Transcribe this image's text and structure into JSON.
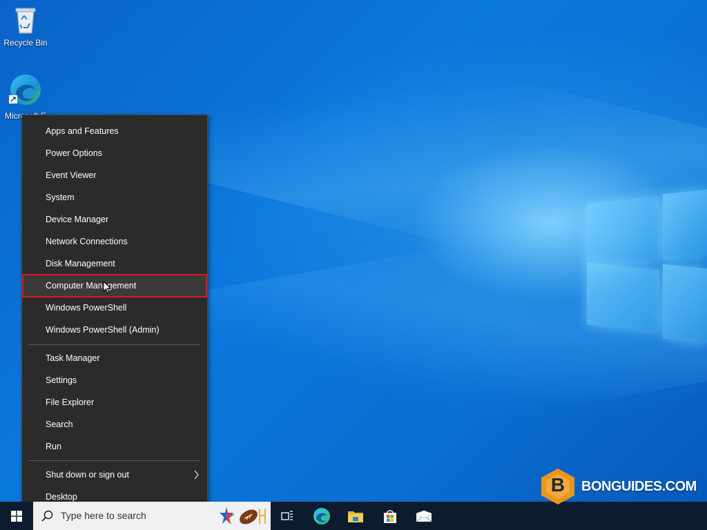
{
  "desktop": {
    "icons": [
      {
        "label": "Recycle Bin",
        "icon": "recycle-bin-icon"
      },
      {
        "label": "Microsoft E",
        "icon": "edge-icon"
      }
    ]
  },
  "context_menu": {
    "group1": [
      "Apps and Features",
      "Power Options",
      "Event Viewer",
      "System",
      "Device Manager",
      "Network Connections",
      "Disk Management",
      "Computer Management",
      "Windows PowerShell",
      "Windows PowerShell (Admin)"
    ],
    "group2": [
      "Task Manager",
      "Settings",
      "File Explorer",
      "Search",
      "Run"
    ],
    "group3": [
      "Shut down or sign out",
      "Desktop"
    ],
    "highlighted": "Computer Management"
  },
  "taskbar": {
    "search_placeholder": "Type here to search",
    "icons": [
      "start-icon",
      "search-icon",
      "task-view-icon",
      "edge-icon",
      "file-explorer-icon",
      "store-icon",
      "mail-icon"
    ]
  },
  "watermark": {
    "text": "BONGUIDES.COM",
    "letter": "B"
  },
  "colors": {
    "menu_bg": "#2b2b2b",
    "highlight": "#e0141e",
    "taskbar": "#0c1b2e",
    "accent_orange": "#e8961e"
  }
}
